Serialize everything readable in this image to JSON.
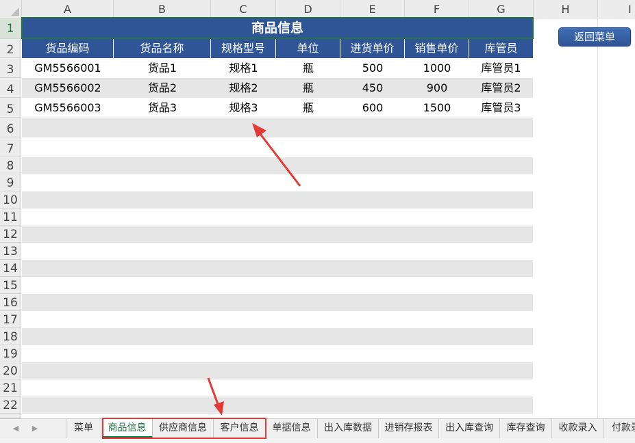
{
  "columns": [
    "A",
    "B",
    "C",
    "D",
    "E",
    "F",
    "G",
    "H",
    "I"
  ],
  "rows": [
    "1",
    "2",
    "3",
    "4",
    "5",
    "6",
    "7",
    "8",
    "9",
    "10",
    "11",
    "12",
    "13",
    "14",
    "15",
    "16",
    "17",
    "18",
    "19",
    "20",
    "21",
    "22"
  ],
  "sheet": {
    "title": "商品信息",
    "headers": [
      "货品编码",
      "货品名称",
      "规格型号",
      "单位",
      "进货单价",
      "销售单价",
      "库管员"
    ],
    "data": [
      [
        "GM5566001",
        "货品1",
        "规格1",
        "瓶",
        "500",
        "1000",
        "库管员1"
      ],
      [
        "GM5566002",
        "货品2",
        "规格2",
        "瓶",
        "450",
        "900",
        "库管员2"
      ],
      [
        "GM5566003",
        "货品3",
        "规格3",
        "瓶",
        "600",
        "1500",
        "库管员3"
      ]
    ]
  },
  "return_button": "返回菜单",
  "tabs": [
    "菜单",
    "商品信息",
    "供应商信息",
    "客户信息",
    "单据信息",
    "出入库数据",
    "进销存报表",
    "出入库查询",
    "库存查询",
    "收款录入",
    "付款录"
  ],
  "active_tab": "商品信息",
  "colors": {
    "header_blue": "#2f5597",
    "band_gray": "#e7e6e6",
    "excel_green": "#217346",
    "annotation_red": "#e53935"
  }
}
